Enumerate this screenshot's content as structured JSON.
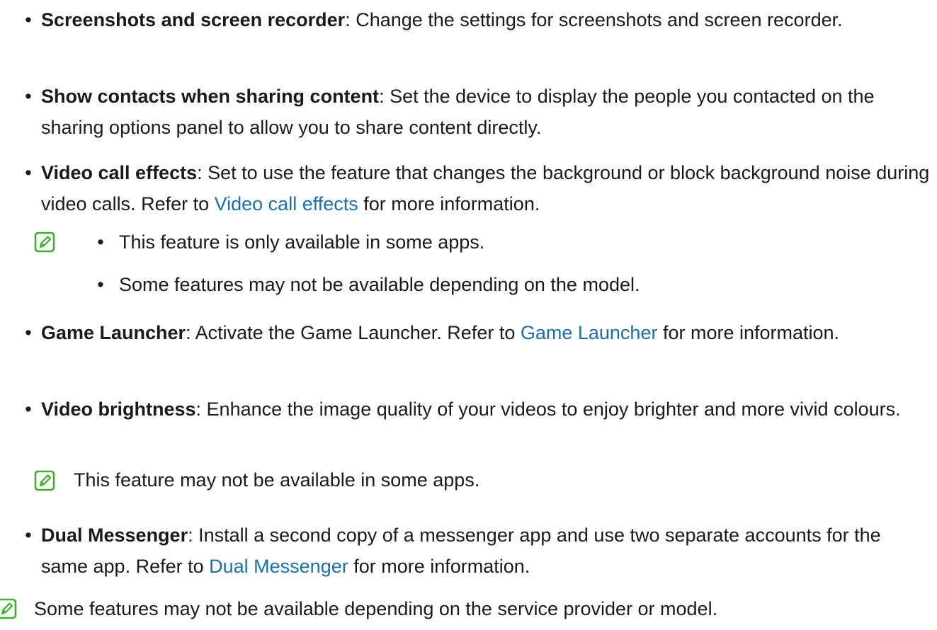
{
  "items": [
    {
      "title": "Screenshots and screen recorder",
      "text": ": Change the settings for screenshots and screen recorder."
    },
    {
      "title": "Show contacts when sharing content",
      "text": ": Set the device to display the people you contacted on the sharing options panel to allow you to share content directly."
    },
    {
      "title": "Video call effects",
      "text_before": ": Set to use the feature that changes the background or block background noise during video calls. Refer to ",
      "link": "Video call effects",
      "text_after": " for more information.",
      "notes": [
        "This feature is only available in some apps.",
        "Some features may not be available depending on the model."
      ]
    },
    {
      "title": "Game Launcher",
      "text_before": ": Activate the Game Launcher. Refer to ",
      "link": "Game Launcher",
      "text_after": " for more information."
    },
    {
      "title": "Video brightness",
      "text": ": Enhance the image quality of your videos to enjoy brighter and more vivid colours.",
      "note": "This feature may not be available in some apps."
    },
    {
      "title": "Dual Messenger",
      "text_before": ": Install a second copy of a messenger app and use two separate accounts for the same app. Refer to ",
      "link": "Dual Messenger",
      "text_after": " for more information."
    }
  ],
  "bullet_glyph": "•",
  "footer_note": "Some features may not be available depending on the service provider or model.",
  "colors": {
    "link": "#1a6fb0",
    "note_icon": "#3fae2a",
    "text": "#1a1a1a"
  },
  "icons": {
    "note": "note-pencil-icon"
  }
}
